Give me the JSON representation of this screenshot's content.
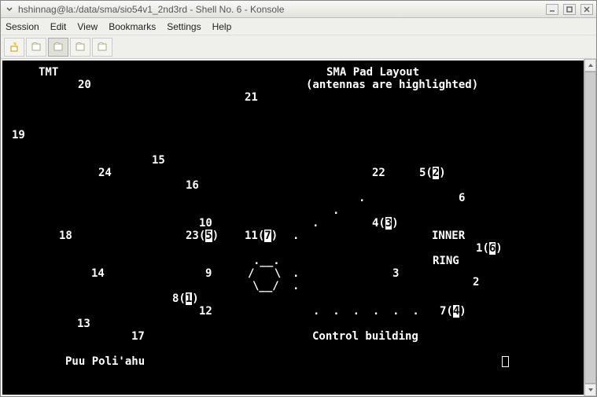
{
  "window": {
    "title": "hshinnag@la:/data/sma/sio54v1_2nd3rd - Shell No. 6 - Konsole"
  },
  "menu": {
    "session": "Session",
    "edit": "Edit",
    "view": "View",
    "bookmarks": "Bookmarks",
    "settings": "Settings",
    "help": "Help"
  },
  "terminal": {
    "tmt": "TMT",
    "title1": "SMA Pad Layout",
    "title2": "(antennas are highlighted)",
    "inner": "INNER",
    "ring": "RING",
    "control": "Control building",
    "puu": "Puu Poli'ahu",
    "pads": {
      "p20": "20",
      "p21": "21",
      "p19": "19",
      "p15": "15",
      "p24": "24",
      "p16": "16",
      "p22": "22",
      "p5_2a": "5(",
      "p5_2b": "2",
      "p5_2c": ")",
      "p6": "6",
      "p10": "10",
      "p18": "18",
      "p23_5a": "23(",
      "p23_5b": "5",
      "p23_5c": ")",
      "p11_7a": "11(",
      "p11_7b": "7",
      "p11_7c": ")",
      "p4_3a": "4(",
      "p4_3b": "3",
      "p4_3c": ")",
      "p1_6a": "1(",
      "p1_6b": "6",
      "p1_6c": ")",
      "p14": "14",
      "p9": "9",
      "p3": "3",
      "p2": "2",
      "p8_1a": "8(",
      "p8_1b": "1",
      "p8_1c": ")",
      "p12": "12",
      "p7_4a": "7(",
      "p7_4b": "4",
      "p7_4c": ")",
      "p13": "13",
      "p17": "17"
    },
    "ascii": {
      "dot1": ".",
      "dot2": ".",
      "dot3": ".",
      "dot4": ".",
      "dot5": ".",
      "dot6": ".",
      "hex1": ".__.",
      "hex2": "/   \\",
      "hex2b": ".",
      "hex3": "\\__/",
      "hex3b": ".",
      "dotrow": ".  .  .  .  .  ."
    }
  }
}
